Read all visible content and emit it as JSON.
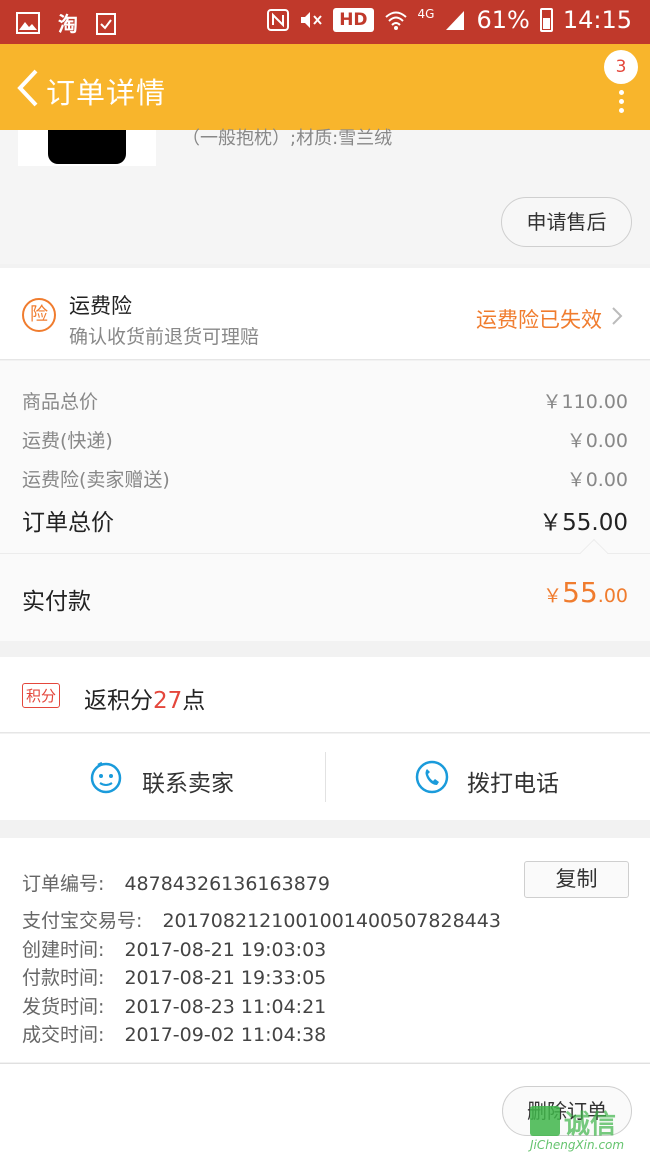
{
  "status_bar": {
    "taobao_label": "淘",
    "hd_label": "HD",
    "network_label": "4G",
    "battery_percent": "61%",
    "time": "14:15",
    "icons": [
      "gallery-icon",
      "taobao-icon",
      "clipboard-icon",
      "nfc-icon",
      "mute-icon",
      "wifi-icon",
      "signal-icon",
      "battery-charging-icon"
    ]
  },
  "header": {
    "title": "订单详情",
    "badge_count": "3",
    "accent_color": "#f8b52c"
  },
  "product": {
    "spec_text": "（一般抱枕）;材质:雪兰绒",
    "after_sale_label": "申请售后"
  },
  "insurance": {
    "icon_text": "险",
    "title": "运费险",
    "subtitle": "确认收货前退货可理赔",
    "status": "运费险已失效"
  },
  "prices": {
    "rows": [
      {
        "label": "商品总价",
        "value": "￥110.00"
      },
      {
        "label": "运费(快递)",
        "value": "￥0.00"
      },
      {
        "label": "运费险(卖家赠送)",
        "value": "￥0.00"
      }
    ],
    "total_label": "订单总价",
    "total_value": "￥55.00",
    "paid_label": "实付款",
    "paid_currency": "￥",
    "paid_int": "55",
    "paid_dec": ".00"
  },
  "points": {
    "badge": "积分",
    "prefix": "返积分",
    "amount": "27",
    "suffix": "点"
  },
  "contact": {
    "seller_label": "联系卖家",
    "phone_label": "拨打电话"
  },
  "order_info": {
    "copy_label": "复制",
    "rows": [
      {
        "label": "订单编号:",
        "value": "48784326136163879"
      },
      {
        "label": "支付宝交易号:",
        "value": "2017082121001001400507828443"
      },
      {
        "label": "创建时间:",
        "value": "2017-08-21 19:03:03"
      },
      {
        "label": "付款时间:",
        "value": "2017-08-21 19:33:05"
      },
      {
        "label": "发货时间:",
        "value": "2017-08-23 11:04:21"
      },
      {
        "label": "成交时间:",
        "value": "2017-09-02 11:04:38"
      }
    ]
  },
  "bottom": {
    "delete_label": "删除订单",
    "watermark_cn": "诚信",
    "watermark_en": "JiChengXin.com"
  }
}
